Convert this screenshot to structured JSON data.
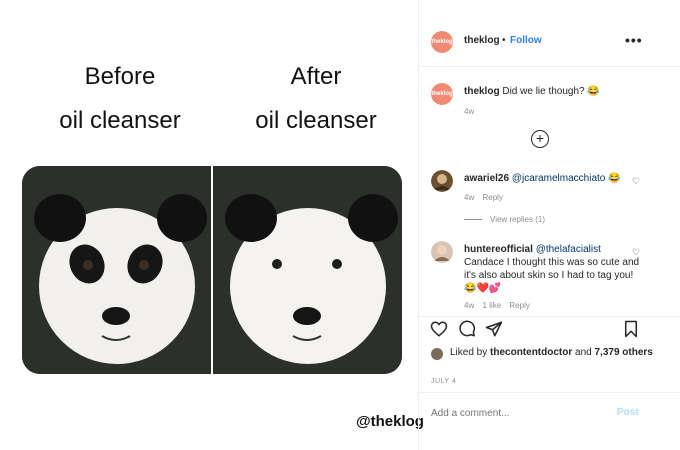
{
  "media": {
    "before_line1": "Before",
    "before_line2": "oil cleanser",
    "after_line1": "After",
    "after_line2": "oil cleanser",
    "watermark": "@theklog"
  },
  "header": {
    "avatar_text": "theklog",
    "username": "theklog",
    "dot": "•",
    "follow": "Follow",
    "more": "•••"
  },
  "caption": {
    "username": "theklog",
    "text": "Did we lie though? 😂",
    "time": "4w"
  },
  "comments": [
    {
      "username": "awariel26",
      "mention": "@jcaramelmacchiato",
      "text": "😂",
      "time": "4w",
      "reply": "Reply",
      "view_replies": "View replies (1)"
    },
    {
      "username": "huntereofficial",
      "mention": "@thelafacialist",
      "text": "Candace I thought this was so cute and it's also about skin so I had to tag you! 😂❤️💕",
      "time": "4w",
      "likes": "1 like",
      "reply": "Reply"
    }
  ],
  "likes": {
    "prefix": "Liked by",
    "user": "thecontentdoctor",
    "middle": "and",
    "others": "7,379 others"
  },
  "date": "JULY 4",
  "add_comment": {
    "placeholder": "Add a comment...",
    "post": "Post"
  },
  "colors": {
    "brand_avatar": "#f08a73",
    "follow_blue": "#2f80ed",
    "post_disabled": "#b3dbff"
  },
  "icons": [
    "heart-icon",
    "comment-icon",
    "share-icon",
    "bookmark-icon",
    "plus-circle-icon",
    "more-icon"
  ]
}
